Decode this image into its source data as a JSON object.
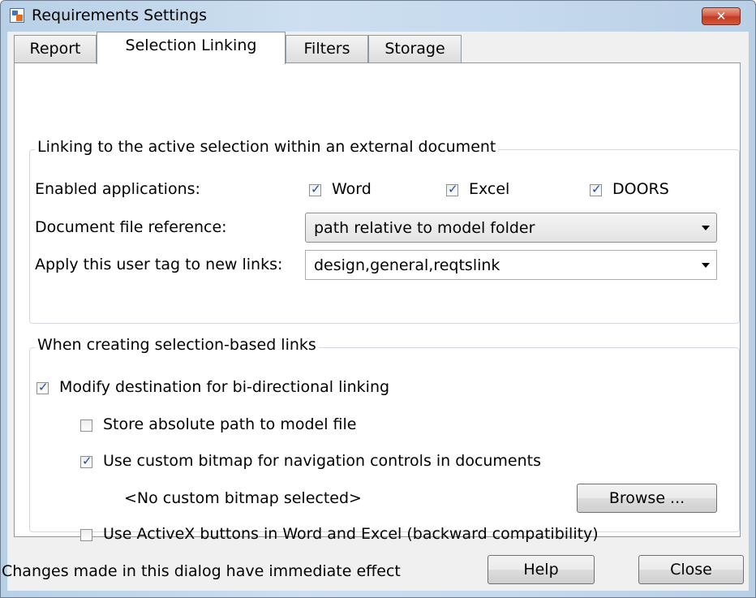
{
  "window": {
    "title": "Requirements Settings",
    "close_glyph": "✕"
  },
  "tabs": [
    {
      "label": "Report",
      "active": false
    },
    {
      "label": "Selection Linking",
      "active": true
    },
    {
      "label": "Filters",
      "active": false
    },
    {
      "label": "Storage",
      "active": false
    }
  ],
  "group_external": {
    "legend": "Linking to the active selection within an external document",
    "enabled_apps_label": "Enabled applications:",
    "apps": [
      {
        "label": "Word",
        "checked": true
      },
      {
        "label": "Excel",
        "checked": true
      },
      {
        "label": "DOORS",
        "checked": true
      }
    ],
    "doc_ref_label": "Document file reference:",
    "doc_ref_value": "path relative to model folder",
    "user_tag_label": "Apply this user tag to new links:",
    "user_tag_value": "design,general,reqtslink"
  },
  "group_selection": {
    "legend": "When creating selection-based links",
    "modify_dest": {
      "label": "Modify destination for bi-directional linking",
      "checked": true
    },
    "store_abs": {
      "label": "Store absolute path to model file",
      "checked": false
    },
    "custom_bitmap": {
      "label": "Use custom bitmap for navigation controls in documents",
      "checked": true
    },
    "bitmap_status": "<No custom bitmap selected>",
    "browse_label": "Browse ...",
    "activex": {
      "label": "Use ActiveX buttons in Word and Excel (backward compatibility)",
      "checked": false
    }
  },
  "footer": {
    "status": "Changes made in this dialog have immediate effect",
    "help_label": "Help",
    "close_label": "Close"
  },
  "colors": {
    "title_bar": "#c5d9ed",
    "close_button": "#c94a32",
    "check_mark": "#1e4e9a",
    "dialog_bg": "#f0f0f0"
  }
}
